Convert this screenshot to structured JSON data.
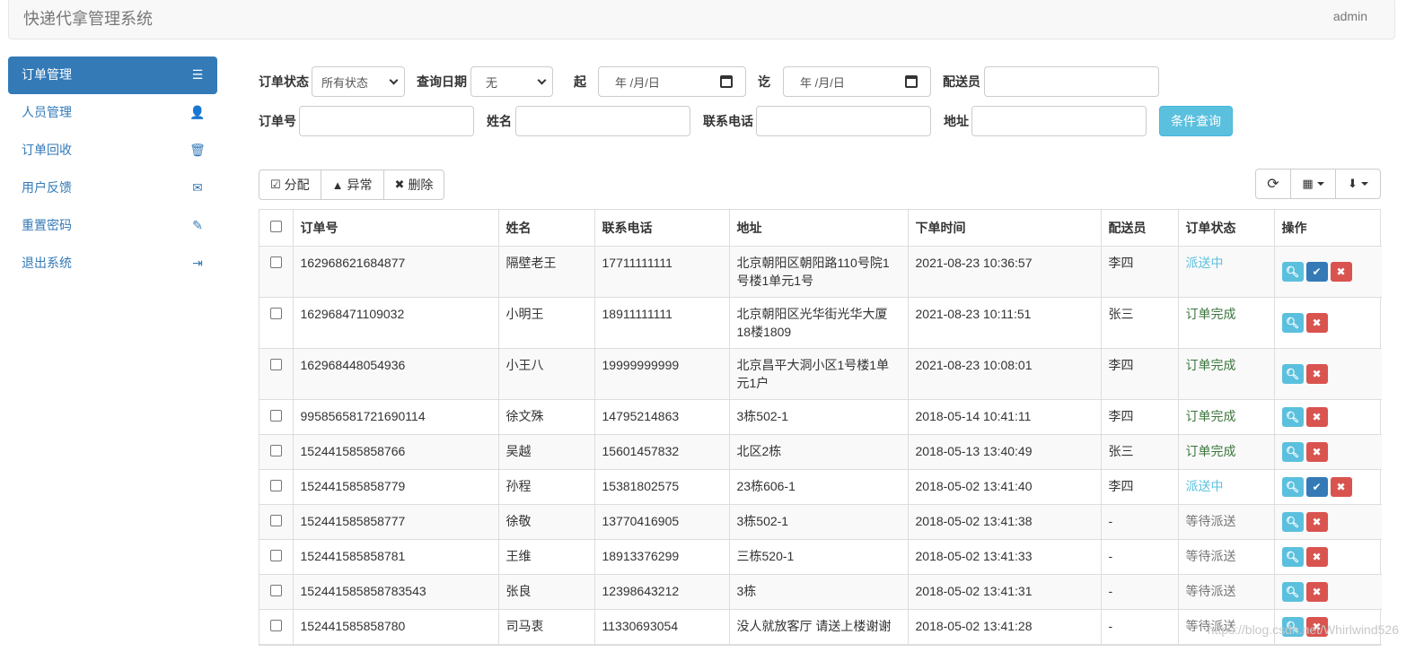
{
  "app": {
    "title": "快递代拿管理系统",
    "user": "admin"
  },
  "sidebar": {
    "items": [
      {
        "label": "订单管理",
        "icon": "list-icon",
        "active": true
      },
      {
        "label": "人员管理",
        "icon": "user-icon",
        "active": false
      },
      {
        "label": "订单回收",
        "icon": "trash-icon",
        "active": false
      },
      {
        "label": "用户反馈",
        "icon": "envelope-icon",
        "active": false
      },
      {
        "label": "重置密码",
        "icon": "pencil-icon",
        "active": false
      },
      {
        "label": "退出系统",
        "icon": "logout-icon",
        "active": false
      }
    ]
  },
  "filters": {
    "status_label": "订单状态",
    "status_value": "所有状态",
    "date_label": "查询日期",
    "date_value": "无",
    "from_label": "起",
    "from_value": "年 /月/日",
    "to_label": "讫",
    "to_value": "年 /月/日",
    "courier_label": "配送员",
    "order_label": "订单号",
    "name_label": "姓名",
    "phone_label": "联系电话",
    "address_label": "地址",
    "query_button": "条件查询"
  },
  "toolbar": {
    "assign": "分配",
    "abnormal": "异常",
    "delete": "删除"
  },
  "table": {
    "headers": [
      "订单号",
      "姓名",
      "联系电话",
      "地址",
      "下单时间",
      "配送员",
      "订单状态",
      "操作"
    ],
    "rows": [
      {
        "order_no": "162968621684877",
        "name": "隔壁老王",
        "phone": "17711111111",
        "address": "北京朝阳区朝阳路110号院1号楼1单元1号",
        "time": "2021-08-23 10:36:57",
        "courier": "李四",
        "status": "派送中",
        "status_type": "blue",
        "can_confirm": true
      },
      {
        "order_no": "162968471109032",
        "name": "小明王",
        "phone": "18911111111",
        "address": "北京朝阳区光华街光华大厦18楼1809",
        "time": "2021-08-23 10:11:51",
        "courier": "张三",
        "status": "订单完成",
        "status_type": "green",
        "can_confirm": false
      },
      {
        "order_no": "162968448054936",
        "name": "小王八",
        "phone": "19999999999",
        "address": "北京昌平大洞小区1号楼1单元1户",
        "time": "2021-08-23 10:08:01",
        "courier": "李四",
        "status": "订单完成",
        "status_type": "green",
        "can_confirm": false
      },
      {
        "order_no": "995856581721690114",
        "name": "徐文殊",
        "phone": "14795214863",
        "address": "3栋502-1",
        "time": "2018-05-14 10:41:11",
        "courier": "李四",
        "status": "订单完成",
        "status_type": "green",
        "can_confirm": false
      },
      {
        "order_no": "152441585858766",
        "name": "吴越",
        "phone": "15601457832",
        "address": "北区2栋",
        "time": "2018-05-13 13:40:49",
        "courier": "张三",
        "status": "订单完成",
        "status_type": "green",
        "can_confirm": false
      },
      {
        "order_no": "152441585858779",
        "name": "孙程",
        "phone": "15381802575",
        "address": "23栋606-1",
        "time": "2018-05-02 13:41:40",
        "courier": "李四",
        "status": "派送中",
        "status_type": "blue",
        "can_confirm": true
      },
      {
        "order_no": "152441585858777",
        "name": "徐敬",
        "phone": "13770416905",
        "address": "3栋502-1",
        "time": "2018-05-02 13:41:38",
        "courier": "-",
        "status": "等待派送",
        "status_type": "gray",
        "can_confirm": false
      },
      {
        "order_no": "152441585858781",
        "name": "王维",
        "phone": "18913376299",
        "address": "三栋520-1",
        "time": "2018-05-02 13:41:33",
        "courier": "-",
        "status": "等待派送",
        "status_type": "gray",
        "can_confirm": false
      },
      {
        "order_no": "152441585858783543",
        "name": "张良",
        "phone": "12398643212",
        "address": "3栋",
        "time": "2018-05-02 13:41:31",
        "courier": "-",
        "status": "等待派送",
        "status_type": "gray",
        "can_confirm": false
      },
      {
        "order_no": "152441585858780",
        "name": "司马衷",
        "phone": "11330693054",
        "address": "没人就放客厅 请送上楼谢谢",
        "time": "2018-05-02 13:41:28",
        "courier": "-",
        "status": "等待派送",
        "status_type": "gray",
        "can_confirm": false
      }
    ]
  },
  "watermark": "https://blog.csdn.net/Whirlwind526",
  "colors": {
    "primary": "#337ab7",
    "info": "#5bc0de",
    "danger": "#d9534f",
    "success_text": "#3c763d"
  }
}
